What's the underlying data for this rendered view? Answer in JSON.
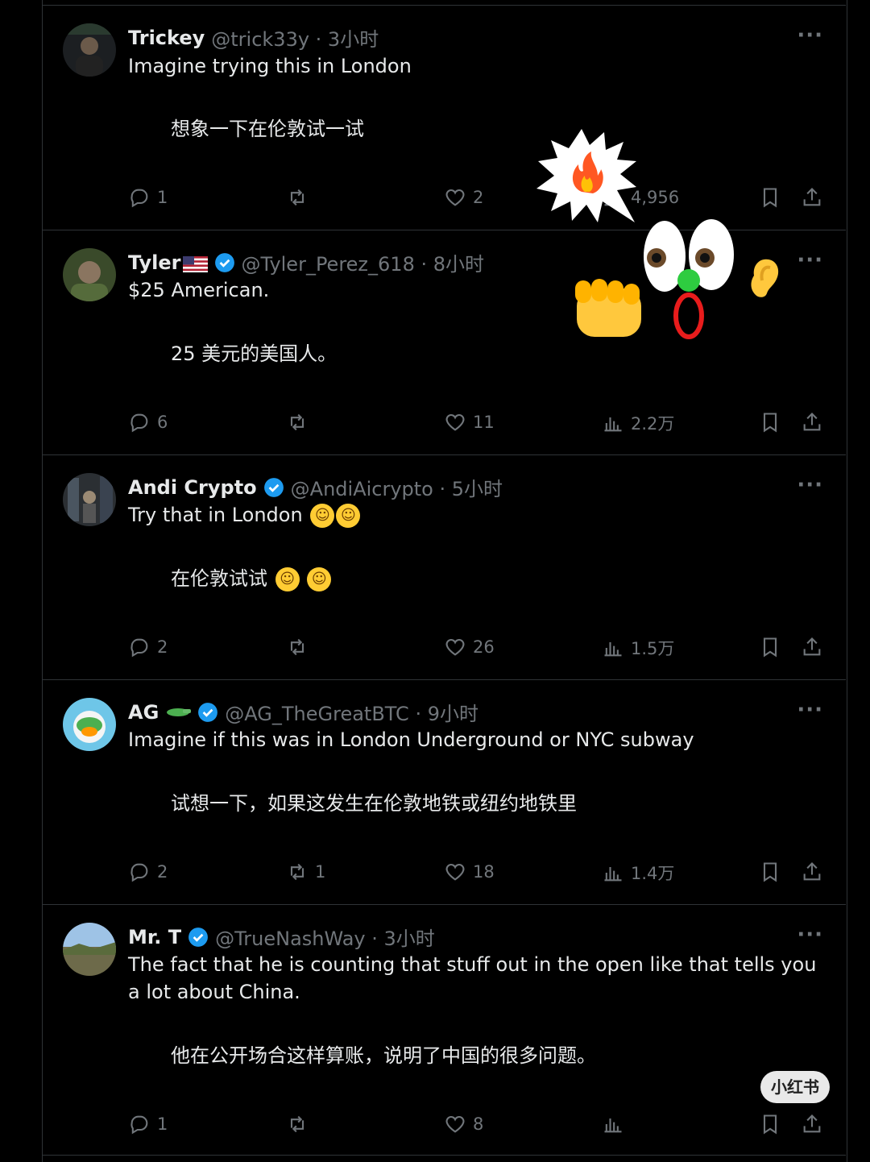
{
  "tweets": [
    {
      "name": "Trickey",
      "handle": "@trick33y · 3小时",
      "text": "Imagine trying this in London",
      "translation": "想象一下在伦敦试一试",
      "replies": "1",
      "retweets": "",
      "likes": "2",
      "views": "4,956"
    },
    {
      "name": "Tyler",
      "handle": "@Tyler_Perez_618 · 8小时",
      "text": "$25 American.",
      "translation": "25 美元的美国人。",
      "replies": "6",
      "retweets": "",
      "likes": "11",
      "views": "2.2万"
    },
    {
      "name": "Andi Crypto",
      "handle": "@AndiAicrypto · 5小时",
      "text": "Try that in London",
      "translation": "在伦敦试试",
      "replies": "2",
      "retweets": "",
      "likes": "26",
      "views": "1.5万"
    },
    {
      "name": "AG",
      "handle": "@AG_TheGreatBTC · 9小时",
      "text": "Imagine if this was in London Underground or NYC subway",
      "translation": "试想一下，如果这发生在伦敦地铁或纽约地铁里",
      "replies": "2",
      "retweets": "1",
      "likes": "18",
      "views": "1.4万"
    },
    {
      "name": "Mr. T",
      "handle": "@TrueNashWay · 3小时",
      "text": "The fact that he is counting that stuff out in the open like that tells you a lot about China.",
      "translation": "他在公开场合这样算账，说明了中国的很多问题。",
      "replies": "1",
      "retweets": "",
      "likes": "8",
      "views": ""
    }
  ],
  "more_label": "···",
  "watermark": "小红书",
  "colors": {
    "background": "#000000",
    "text": "#e7e9ea",
    "muted": "#71767b",
    "verified": "#1d9bf0",
    "border": "#2f3336"
  }
}
